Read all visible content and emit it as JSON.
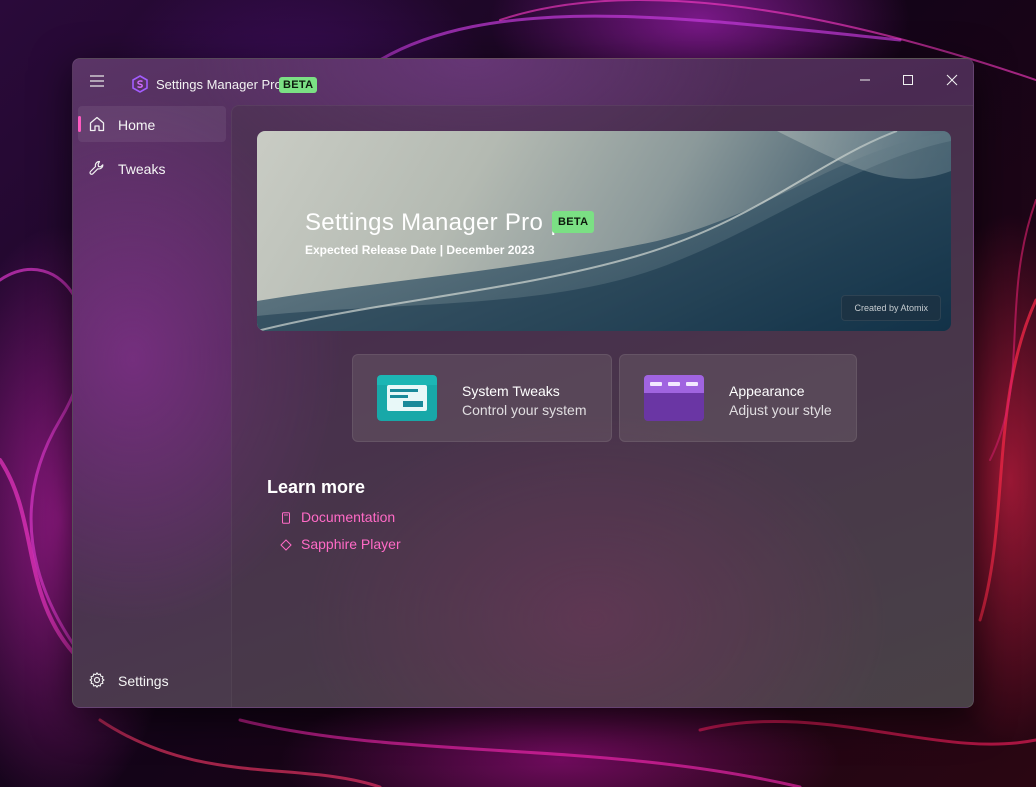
{
  "app": {
    "title": "Settings Manager Pro",
    "beta_badge": "BETA"
  },
  "window_controls": {
    "minimize": "minimize-icon",
    "maximize": "maximize-icon",
    "close": "close-icon"
  },
  "sidebar": {
    "items": [
      {
        "label": "Home",
        "icon": "home-icon",
        "active": true
      },
      {
        "label": "Tweaks",
        "icon": "wrench-icon",
        "active": false
      }
    ],
    "footer": {
      "label": "Settings",
      "icon": "gear-icon"
    }
  },
  "hero": {
    "title": "Settings Manager Pro |",
    "badge": "BETA",
    "subtitle": "Expected Release Date | December 2023",
    "credit": "Created by Atomix"
  },
  "cards": [
    {
      "title": "System Tweaks",
      "subtitle": "Control your system",
      "icon": "system-tweaks-icon"
    },
    {
      "title": "Appearance",
      "subtitle": "Adjust your style",
      "icon": "appearance-icon"
    }
  ],
  "learn_more": {
    "title": "Learn more",
    "links": [
      {
        "label": "Documentation",
        "icon": "document-icon"
      },
      {
        "label": "Sapphire Player",
        "icon": "diamond-icon"
      }
    ]
  },
  "colors": {
    "accent": "#ff5ac0",
    "link": "#ff6ac6",
    "beta_badge": "#7be084"
  }
}
